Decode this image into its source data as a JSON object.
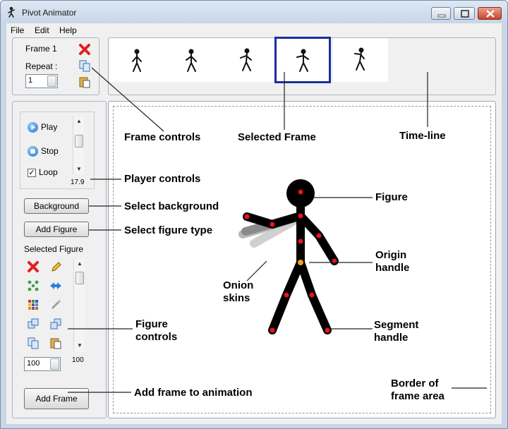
{
  "window": {
    "title": "Pivot Animator"
  },
  "menu": [
    "File",
    "Edit",
    "Help"
  ],
  "frame_controls": {
    "frame_label": "Frame 1",
    "repeat_label": "Repeat :",
    "repeat_value": "1"
  },
  "player": {
    "play_label": "Play",
    "stop_label": "Stop",
    "loop_label": "Loop",
    "speed_value": "17.9"
  },
  "buttons": {
    "background": "Background",
    "add_figure": "Add Figure",
    "add_frame": "Add Frame"
  },
  "selected_figure": {
    "label": "Selected Figure",
    "scale_value": "100",
    "scroll_value": "100"
  },
  "annotations": {
    "frame_controls": "Frame controls",
    "selected_frame": "Selected Frame",
    "time_line": "Time-line",
    "player_controls": "Player controls",
    "select_background": "Select background",
    "select_figure_type": "Select figure type",
    "figure": "Figure",
    "origin_handle_1": "Origin",
    "origin_handle_2": "handle",
    "onion_skins_1": "Onion",
    "onion_skins_2": "skins",
    "figure_controls_1": "Figure",
    "figure_controls_2": "controls",
    "segment_handle_1": "Segment",
    "segment_handle_2": "handle",
    "add_frame_to_animation": "Add frame to animation",
    "border_1": "Border of",
    "border_2": "frame area"
  },
  "icons": [
    "delete-frame-icon",
    "copy-frame-icon",
    "paste-frame-icon",
    "play-icon",
    "stop-icon",
    "delete-figure-icon",
    "edit-figure-icon",
    "center-figure-icon",
    "flip-figure-icon",
    "color-figure-icon",
    "join-figure-icon",
    "front-icon",
    "back-icon",
    "copy-figure-icon",
    "paste-figure-icon"
  ],
  "colors": {
    "selection_border": "#1c2e9c",
    "joint_red": "#e8141b",
    "origin_orange": "#f0a020"
  }
}
